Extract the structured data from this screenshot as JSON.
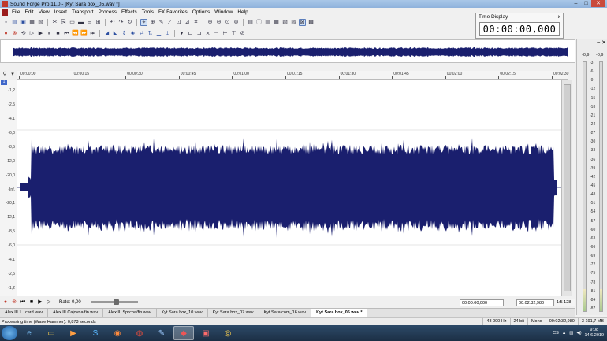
{
  "window": {
    "title": "Sound Forge Pro 11.0 - [Kyt Sara box_05.wav *]"
  },
  "menu": {
    "items": [
      "File",
      "Edit",
      "View",
      "Insert",
      "Transport",
      "Process",
      "Effects",
      "Tools",
      "FX Favorites",
      "Options",
      "Window",
      "Help"
    ]
  },
  "time_display": {
    "label": "Time Display",
    "close": "x",
    "value": "00:00:00,000"
  },
  "ruler": {
    "labels": [
      "00:00:00",
      "00:00:15",
      "00:00:30",
      "00:00:45",
      "00:01:00",
      "00:01:15",
      "00:01:30",
      "00:01:45",
      "00:02:00",
      "00:02:15",
      "00:02:30"
    ]
  },
  "db_scale": {
    "labels": [
      "-1,2",
      "-2,5",
      "-4,1",
      "-6,0",
      "-8,5",
      "-12,0",
      "-20,0",
      "-Inf.",
      "-20,1",
      "-12,1",
      "-8,5",
      "-6,0",
      "-4,1",
      "-2,5",
      "-1,2"
    ]
  },
  "vu": {
    "peak_left": "-0,9",
    "peak_right": "-0,9",
    "labels": [
      "3",
      "6",
      "9",
      "12",
      "15",
      "18",
      "21",
      "24",
      "27",
      "30",
      "33",
      "36",
      "39",
      "42",
      "45",
      "48",
      "51",
      "54",
      "57",
      "60",
      "63",
      "66",
      "69",
      "72",
      "75",
      "78",
      "81",
      "84",
      "87"
    ],
    "fill_left": 0.09,
    "fill_right": 0.09
  },
  "transport": {
    "rate_label": "Rate: 0,00",
    "selection_start": "00:00:00,000",
    "selection_end": "00:02:32,980",
    "zoom_ratio": "1:5 128"
  },
  "tabs": [
    {
      "label": "Alex III 1...card.wav",
      "active": false
    },
    {
      "label": "Alex III Cajovna/fin.wav",
      "active": false
    },
    {
      "label": "Alex III Sprcha/fin.wav",
      "active": false
    },
    {
      "label": "Kyt Sara box_10.wav",
      "active": false
    },
    {
      "label": "Kyt Sara box_07.wav",
      "active": false
    },
    {
      "label": "Kyt Sara com_16.wav",
      "active": false
    },
    {
      "label": "Kyt Sara box_05.wav *",
      "active": true
    }
  ],
  "status": {
    "message": "Processing time (Wave Hammer): 0,873 seconds",
    "sample_rate": "48 000 Hz",
    "bit_depth": "24 bit",
    "channels": "Mono",
    "length": "00:02:32,980",
    "disk": "3 191,7 MB"
  },
  "taskbar": {
    "clock_time": "9:08",
    "clock_date": "14.6.2019",
    "lang": "CS"
  },
  "colors": {
    "waveform": "#1a1f6e",
    "selection": "#3e66c9"
  }
}
